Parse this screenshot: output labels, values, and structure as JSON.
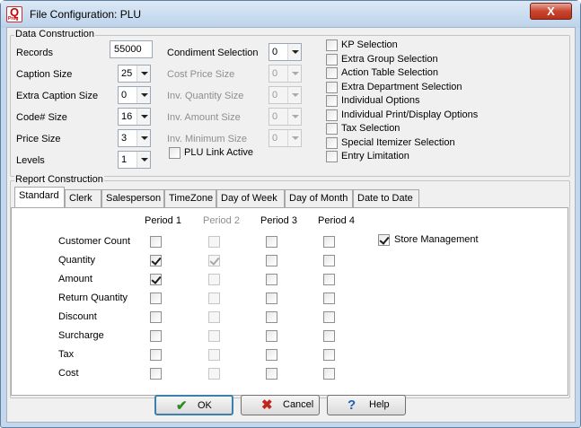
{
  "window": {
    "title": "File Configuration: PLU",
    "close_label": "X",
    "app_icon_letter": "Q",
    "app_icon_caption": "Prog"
  },
  "data_construction": {
    "label": "Data Construction",
    "records": {
      "label": "Records",
      "value": "55000"
    },
    "left_fields": [
      {
        "label": "Caption Size",
        "value": "25"
      },
      {
        "label": "Extra Caption Size",
        "value": "0"
      },
      {
        "label": "Code# Size",
        "value": "16"
      },
      {
        "label": "Price Size",
        "value": "3"
      },
      {
        "label": "Levels",
        "value": "1"
      }
    ],
    "middle_fields": [
      {
        "label": "Condiment Selection",
        "value": "0",
        "enabled": true
      },
      {
        "label": "Cost Price Size",
        "value": "0",
        "enabled": false
      },
      {
        "label": "Inv. Quantity Size",
        "value": "0",
        "enabled": false
      },
      {
        "label": "Inv. Amount Size",
        "value": "0",
        "enabled": false
      },
      {
        "label": "Inv. Minimum Size",
        "value": "0",
        "enabled": false
      }
    ],
    "plu_link_active": {
      "label": "PLU Link Active",
      "checked": false
    },
    "options": [
      {
        "label": "KP Selection",
        "checked": false
      },
      {
        "label": "Extra Group Selection",
        "checked": false
      },
      {
        "label": "Action Table Selection",
        "checked": false
      },
      {
        "label": "Extra Department Selection",
        "checked": false
      },
      {
        "label": "Individual Options",
        "checked": false
      },
      {
        "label": "Individual Print/Display Options",
        "checked": false
      },
      {
        "label": "Tax Selection",
        "checked": false
      },
      {
        "label": "Special Itemizer Selection",
        "checked": false
      },
      {
        "label": "Entry Limitation",
        "checked": false
      }
    ]
  },
  "report_construction": {
    "label": "Report Construction",
    "tabs": [
      {
        "label": "Standard",
        "active": true
      },
      {
        "label": "Clerk",
        "active": false
      },
      {
        "label": "Salesperson",
        "active": false
      },
      {
        "label": "TimeZone",
        "active": false
      },
      {
        "label": "Day of Week",
        "active": false
      },
      {
        "label": "Day of Month",
        "active": false
      },
      {
        "label": "Date to Date",
        "active": false
      }
    ],
    "periods": [
      {
        "label": "Period 1",
        "enabled": true
      },
      {
        "label": "Period 2",
        "enabled": false
      },
      {
        "label": "Period 3",
        "enabled": true
      },
      {
        "label": "Period 4",
        "enabled": true
      }
    ],
    "rows": [
      {
        "label": "Customer Count",
        "checks": [
          false,
          false,
          false,
          false
        ]
      },
      {
        "label": "Quantity",
        "checks": [
          true,
          true,
          false,
          false
        ]
      },
      {
        "label": "Amount",
        "checks": [
          true,
          false,
          false,
          false
        ]
      },
      {
        "label": "Return Quantity",
        "checks": [
          false,
          false,
          false,
          false
        ]
      },
      {
        "label": "Discount",
        "checks": [
          false,
          false,
          false,
          false
        ]
      },
      {
        "label": "Surcharge",
        "checks": [
          false,
          false,
          false,
          false
        ]
      },
      {
        "label": "Tax",
        "checks": [
          false,
          false,
          false,
          false
        ]
      },
      {
        "label": "Cost",
        "checks": [
          false,
          false,
          false,
          false
        ]
      }
    ],
    "store_management": {
      "label": "Store Management",
      "checked": true
    }
  },
  "buttons": [
    {
      "label": "OK",
      "icon": "checkmark-icon",
      "color": "#2e8b22"
    },
    {
      "label": "Cancel",
      "icon": "x-icon",
      "color": "#c0261b"
    },
    {
      "label": "Help",
      "icon": "question-icon",
      "color": "#1f5fb4"
    }
  ]
}
